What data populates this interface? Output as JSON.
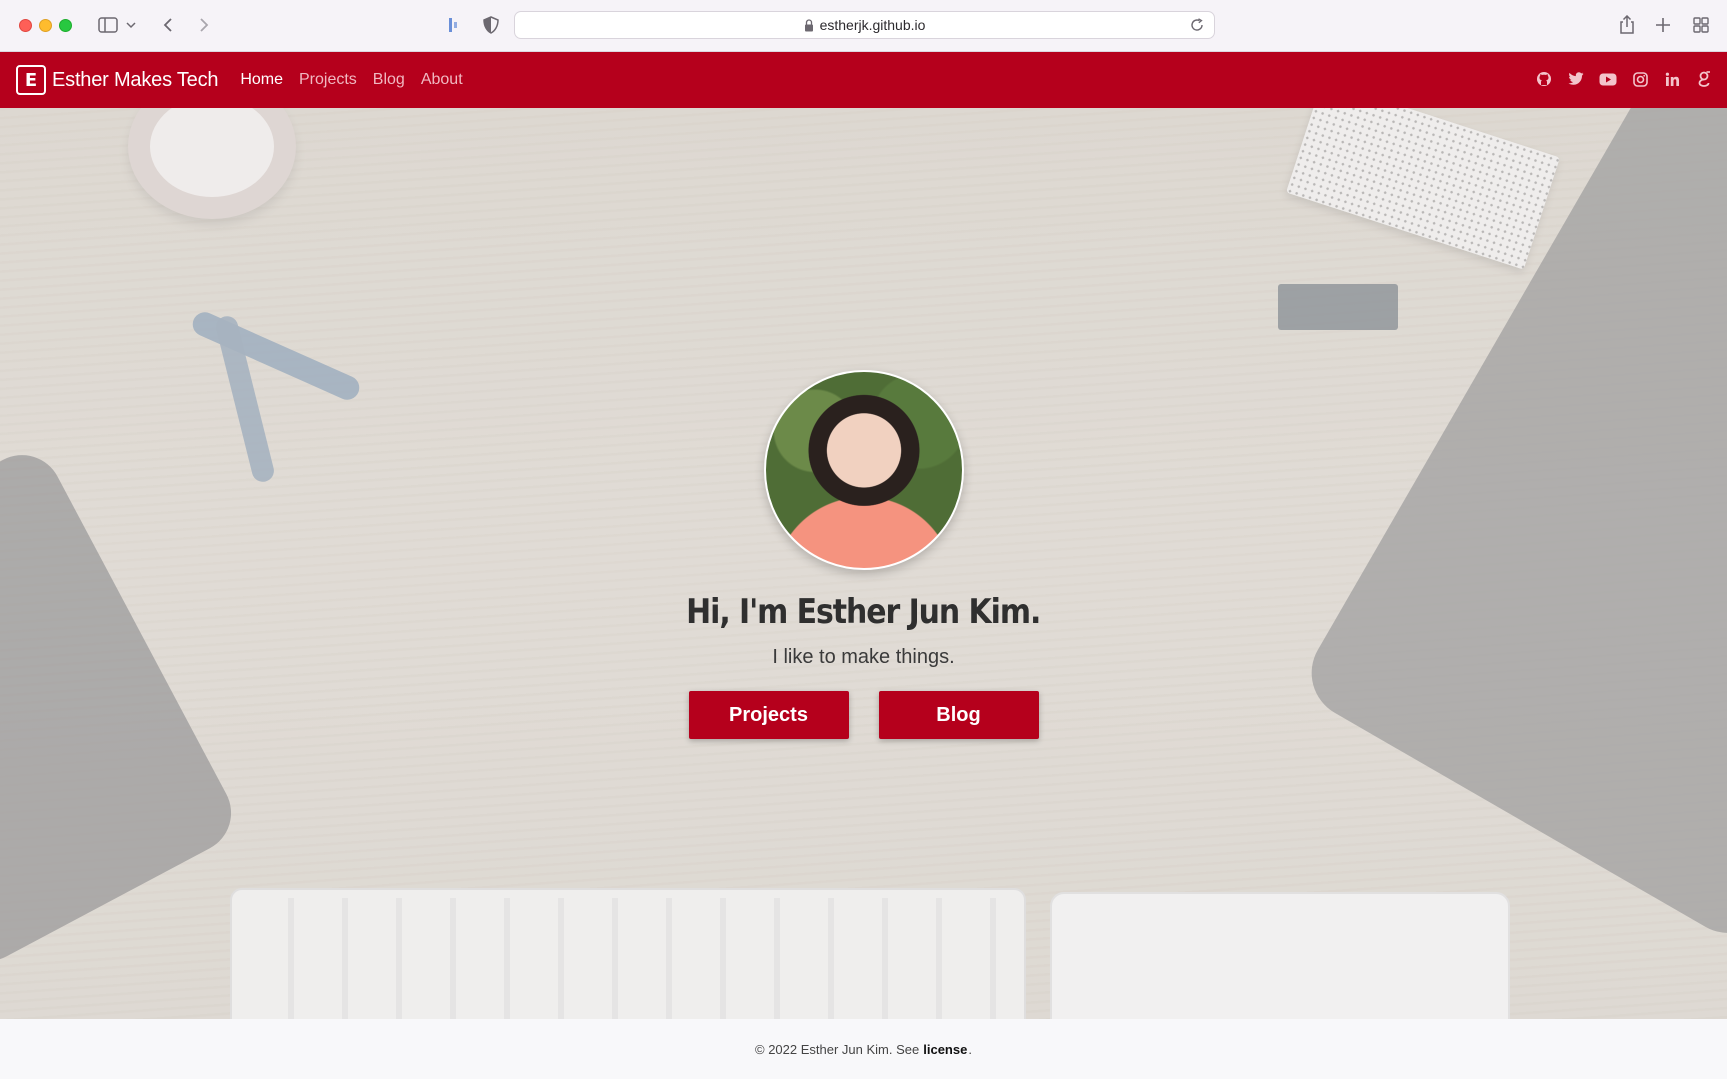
{
  "browser": {
    "url": "estherjk.github.io",
    "icons": [
      "sidebar-icon",
      "chevron-down-icon",
      "back-icon",
      "forward-icon",
      "extension-icon",
      "privacy-shield-icon",
      "lock-icon",
      "reload-icon",
      "share-icon",
      "new-tab-icon",
      "tab-overview-icon"
    ]
  },
  "navbar": {
    "brand_letter": "E",
    "brand_name": "Esther Makes Tech",
    "links": [
      {
        "label": "Home",
        "active": true
      },
      {
        "label": "Projects",
        "active": false
      },
      {
        "label": "Blog",
        "active": false
      },
      {
        "label": "About",
        "active": false
      }
    ],
    "social_icons": [
      "github-icon",
      "twitter-icon",
      "youtube-icon",
      "instagram-icon",
      "linkedin-icon",
      "google-scholar-icon"
    ],
    "colors": {
      "background": "#b5001c",
      "active_link": "#ffffff",
      "inactive_link": "#f0b8c1"
    }
  },
  "hero": {
    "title": "Hi, I'm Esther Jun Kim.",
    "subtitle": "I like to make things.",
    "buttons": {
      "projects": "Projects",
      "blog": "Blog"
    }
  },
  "footer": {
    "prefix": "© 2022 Esther Jun Kim. See",
    "link": "license",
    "suffix": "."
  }
}
